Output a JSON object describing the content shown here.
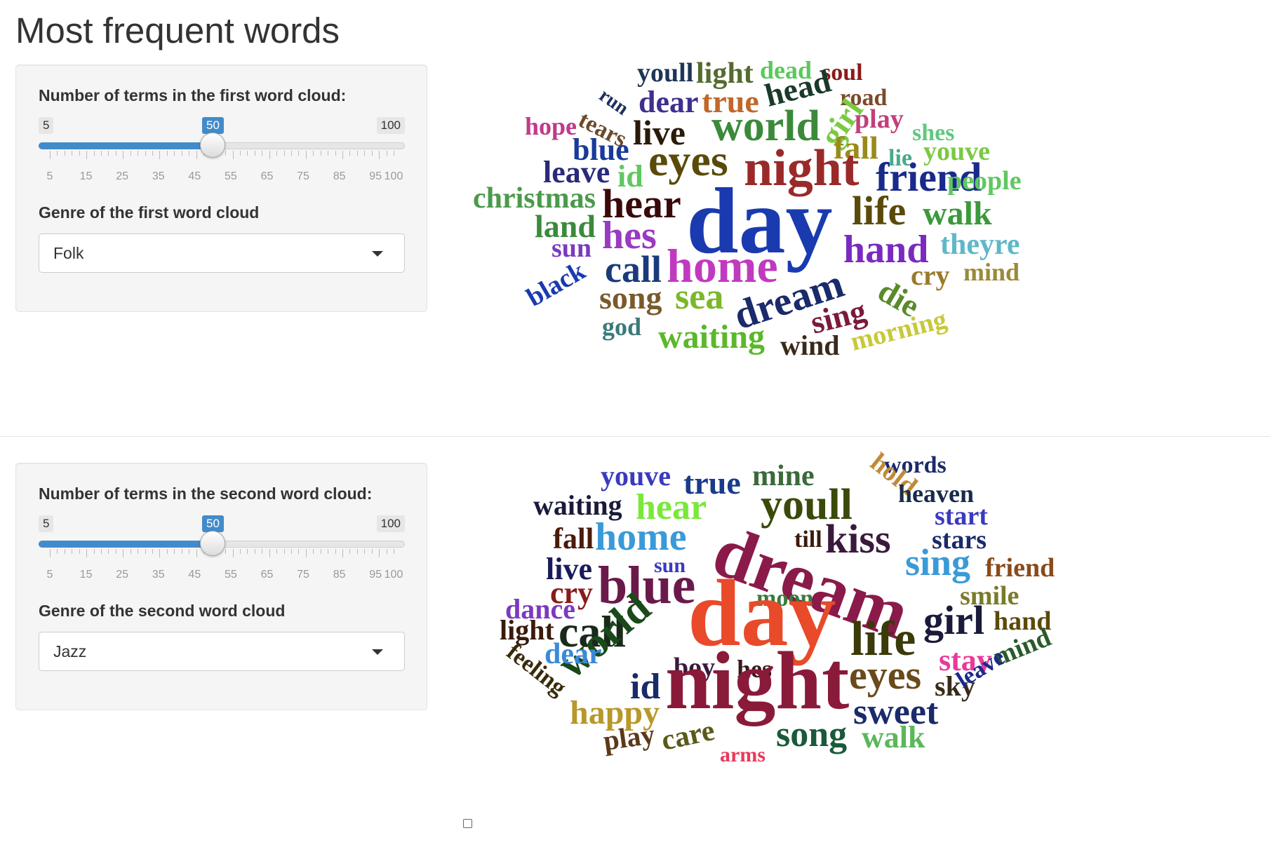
{
  "page": {
    "title": "Most frequent words"
  },
  "panel1": {
    "slider_label": "Number of terms in the first word cloud:",
    "slider": {
      "min": 5,
      "max": 100,
      "value": 50,
      "min_label": "5",
      "max_label": "100",
      "value_label": "50",
      "tick_labels": [
        "5",
        "15",
        "25",
        "35",
        "45",
        "55",
        "65",
        "75",
        "85",
        "95",
        "100"
      ]
    },
    "genre_label": "Genre of the first word cloud",
    "genre_selected": "Folk"
  },
  "panel2": {
    "slider_label": "Number of terms in the second word cloud:",
    "slider": {
      "min": 5,
      "max": 100,
      "value": 50,
      "min_label": "5",
      "max_label": "100",
      "value_label": "50",
      "tick_labels": [
        "5",
        "15",
        "25",
        "35",
        "45",
        "55",
        "65",
        "75",
        "85",
        "95",
        "100"
      ]
    },
    "genre_label": "Genre of the second word cloud",
    "genre_selected": "Jazz"
  },
  "cloud1": {
    "words": [
      {
        "text": "youll",
        "color": "#1d3557"
      },
      {
        "text": "light",
        "color": "#556b2f"
      },
      {
        "text": "dead",
        "color": "#5bc85b"
      },
      {
        "text": "soul",
        "color": "#8b1a1a"
      },
      {
        "text": "run",
        "color": "#1f2f5f"
      },
      {
        "text": "dear",
        "color": "#3f2f8f"
      },
      {
        "text": "true",
        "color": "#c0682a"
      },
      {
        "text": "head",
        "color": "#1a3a2a"
      },
      {
        "text": "road",
        "color": "#7a4a2a"
      },
      {
        "text": "tears",
        "color": "#6b4a2a"
      },
      {
        "text": "girl",
        "color": "#7ac943"
      },
      {
        "text": "play",
        "color": "#c0407a"
      },
      {
        "text": "hope",
        "color": "#c03a8a"
      },
      {
        "text": "live",
        "color": "#2a1a0a"
      },
      {
        "text": "world",
        "color": "#3a8a3a"
      },
      {
        "text": "shes",
        "color": "#5fc87f"
      },
      {
        "text": "fall",
        "color": "#9a8a1a"
      },
      {
        "text": "blue",
        "color": "#1a3a9a"
      },
      {
        "text": "lie",
        "color": "#4aa88a"
      },
      {
        "text": "youve",
        "color": "#7ac943"
      },
      {
        "text": "leave",
        "color": "#2a2a7a"
      },
      {
        "text": "id",
        "color": "#5fc85f"
      },
      {
        "text": "eyes",
        "color": "#5a4a0a"
      },
      {
        "text": "night",
        "color": "#9a2a2a"
      },
      {
        "text": "friend",
        "color": "#1a2a8a"
      },
      {
        "text": "people",
        "color": "#5fc85f"
      },
      {
        "text": "christmas",
        "color": "#4a9a4a"
      },
      {
        "text": "hear",
        "color": "#3a0a0a"
      },
      {
        "text": "day",
        "color": "#1a3ab0"
      },
      {
        "text": "life",
        "color": "#5a4a0a"
      },
      {
        "text": "walk",
        "color": "#3a9a3a"
      },
      {
        "text": "land",
        "color": "#3a8a3a"
      },
      {
        "text": "hes",
        "color": "#9a3ac0"
      },
      {
        "text": "theyre",
        "color": "#5fb8c8"
      },
      {
        "text": "sun",
        "color": "#7a3ac0"
      },
      {
        "text": "hand",
        "color": "#7a2ac0"
      },
      {
        "text": "home",
        "color": "#c03ac0"
      },
      {
        "text": "cry",
        "color": "#9a7a2a"
      },
      {
        "text": "mind",
        "color": "#9a8a3a"
      },
      {
        "text": "black",
        "color": "#1a3ab0"
      },
      {
        "text": "call",
        "color": "#1a3a7a"
      },
      {
        "text": "die",
        "color": "#5a8a2a"
      },
      {
        "text": "dream",
        "color": "#1a2a6a"
      },
      {
        "text": "song",
        "color": "#7a5a2a"
      },
      {
        "text": "sea",
        "color": "#7ab82a"
      },
      {
        "text": "god",
        "color": "#3a7a7a"
      },
      {
        "text": "sing",
        "color": "#7a1a3a"
      },
      {
        "text": "waiting",
        "color": "#5ab82a"
      },
      {
        "text": "wind",
        "color": "#3a2a1a"
      },
      {
        "text": "morning",
        "color": "#c8c83a"
      }
    ]
  },
  "cloud2": {
    "words": [
      {
        "text": "words",
        "color": "#1a2a6a"
      },
      {
        "text": "youve",
        "color": "#3a3ac0"
      },
      {
        "text": "true",
        "color": "#1a3a8a"
      },
      {
        "text": "mine",
        "color": "#3a6a3a"
      },
      {
        "text": "hold",
        "color": "#c08a3a"
      },
      {
        "text": "heaven",
        "color": "#1a2a4a"
      },
      {
        "text": "waiting",
        "color": "#1a1a3a"
      },
      {
        "text": "hear",
        "color": "#7ae83a"
      },
      {
        "text": "youll",
        "color": "#3a4a0a"
      },
      {
        "text": "start",
        "color": "#3a3ac0"
      },
      {
        "text": "fall",
        "color": "#4a1a0a"
      },
      {
        "text": "home",
        "color": "#3a9ad8"
      },
      {
        "text": "till",
        "color": "#3a1a0a"
      },
      {
        "text": "kiss",
        "color": "#3a1a3a"
      },
      {
        "text": "stars",
        "color": "#1a2a6a"
      },
      {
        "text": "dream",
        "color": "#8a1a4a"
      },
      {
        "text": "live",
        "color": "#1a1a5a"
      },
      {
        "text": "sun",
        "color": "#3a3ac0"
      },
      {
        "text": "sing",
        "color": "#3a9ad8"
      },
      {
        "text": "friend",
        "color": "#8a4a1a"
      },
      {
        "text": "blue",
        "color": "#6a1a4a"
      },
      {
        "text": "cry",
        "color": "#8a1a1a"
      },
      {
        "text": "moon",
        "color": "#3a7a3a"
      },
      {
        "text": "smile",
        "color": "#7a7a2a"
      },
      {
        "text": "dance",
        "color": "#7a3ac0"
      },
      {
        "text": "day",
        "color": "#e84a2a"
      },
      {
        "text": "hand",
        "color": "#5a4a0a"
      },
      {
        "text": "light",
        "color": "#3a1a0a"
      },
      {
        "text": "call",
        "color": "#1a2a1a"
      },
      {
        "text": "girl",
        "color": "#1a1a3a"
      },
      {
        "text": "world",
        "color": "#1a4a1a"
      },
      {
        "text": "life",
        "color": "#3a3a0a"
      },
      {
        "text": "dear",
        "color": "#3a8ad8"
      },
      {
        "text": "stay",
        "color": "#e83a9a"
      },
      {
        "text": "mind",
        "color": "#2a5a2a"
      },
      {
        "text": "feeling",
        "color": "#3a2a0a"
      },
      {
        "text": "boy",
        "color": "#3a1a3a"
      },
      {
        "text": "hes",
        "color": "#3a1a1a"
      },
      {
        "text": "eyes",
        "color": "#6a4a1a"
      },
      {
        "text": "sky",
        "color": "#3a2a1a"
      },
      {
        "text": "id",
        "color": "#1a2a6a"
      },
      {
        "text": "night",
        "color": "#8a1a3a"
      },
      {
        "text": "leave",
        "color": "#1a2a8a"
      },
      {
        "text": "sweet",
        "color": "#1a2a6a"
      },
      {
        "text": "happy",
        "color": "#b8982a"
      },
      {
        "text": "play",
        "color": "#5a3a1a"
      },
      {
        "text": "care",
        "color": "#5a5a1a"
      },
      {
        "text": "arms",
        "color": "#e83a5a"
      },
      {
        "text": "song",
        "color": "#1a5a3a"
      },
      {
        "text": "walk",
        "color": "#5ab85a"
      }
    ]
  }
}
